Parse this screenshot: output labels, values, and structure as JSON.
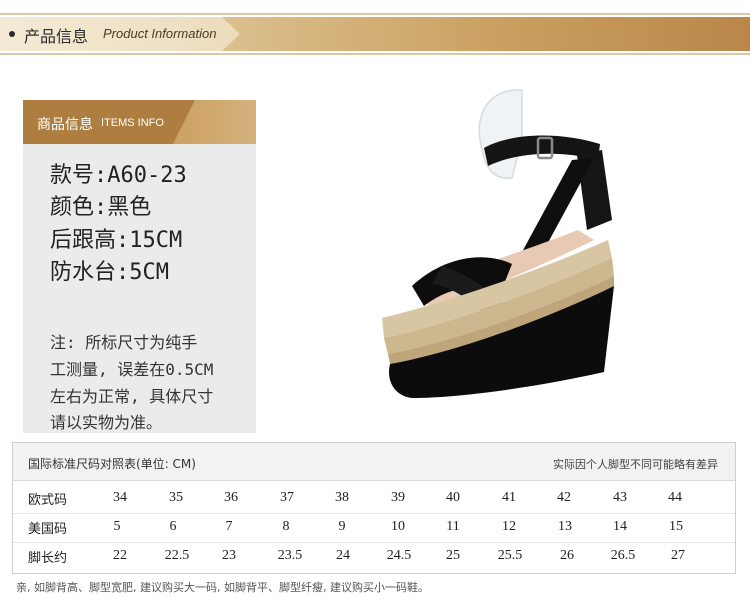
{
  "header": {
    "title_cn": "产品信息",
    "title_en": "Product Information"
  },
  "info": {
    "tab_cn": "商品信息",
    "tab_en": "ITEMS INFO",
    "specs": [
      "款号:A60-23",
      "颜色:黑色",
      "后跟高:15CM",
      "防水台:5CM"
    ],
    "note_lines": [
      "注: 所标尺寸为纯手",
      "工测量, 误差在0.5CM",
      "左右为正常, 具体尺寸",
      "请以实物为准。"
    ]
  },
  "size_chart": {
    "title": "国际标准尺码对照表(单位: CM)",
    "remark": "实际因个人脚型不同可能略有差异",
    "rows": [
      {
        "label": "欧式码",
        "values": [
          "34",
          "35",
          "36",
          "37",
          "38",
          "39",
          "40",
          "41",
          "42",
          "43",
          "44"
        ]
      },
      {
        "label": "美国码",
        "values": [
          "5",
          "6",
          "7",
          "8",
          "9",
          "10",
          "11",
          "12",
          "13",
          "14",
          "15"
        ]
      },
      {
        "label": "脚长约",
        "values": [
          "22",
          "22.5",
          "23",
          "23.5",
          "24",
          "24.5",
          "25",
          "25.5",
          "26",
          "26.5",
          "27"
        ]
      }
    ]
  },
  "footer": "亲, 如脚背高、脚型宽肥, 建议购买大一码, 如脚背平、脚型纤瘦, 建议购买小一码鞋。",
  "colors": {
    "accent": "#c89a5a",
    "accent_dark": "#ad7e40",
    "panel_bg": "#ebebeb",
    "shoe_suede": "#111111",
    "shoe_rope": "#d8c6a2"
  },
  "images": {
    "product": "wedge-sandal-black-suede"
  }
}
